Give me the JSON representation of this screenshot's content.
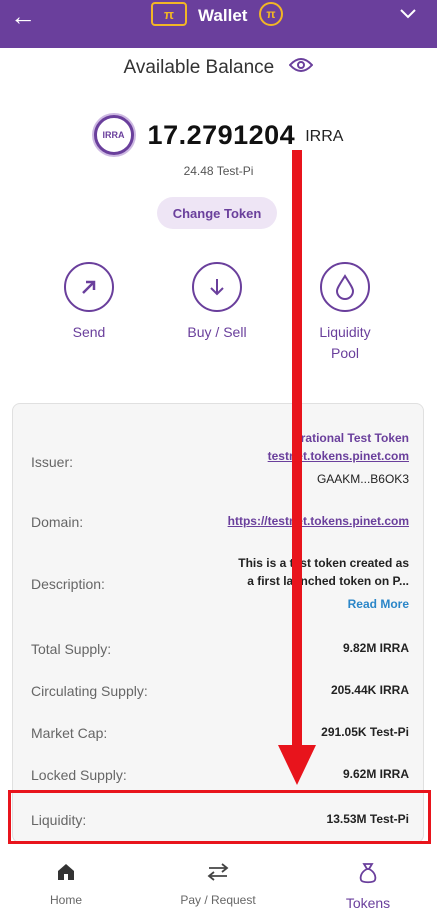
{
  "header": {
    "back_icon": "arrow-left-icon",
    "logo_text": "π",
    "title": "Wallet",
    "pi_coin": "π",
    "chevron_icon": "chevron-down-icon"
  },
  "balance": {
    "available_label": "Available Balance",
    "token_logo_text": "IRRA",
    "amount": "17.2791204",
    "unit": "IRRA",
    "testpi_equiv": "24.48 Test-Pi",
    "change_token_label": "Change Token"
  },
  "actions": [
    {
      "label": "Send",
      "icon": "arrow-up-right-icon"
    },
    {
      "label": "Buy / Sell",
      "icon": "arrow-down-icon"
    },
    {
      "label": "Liquidity\nPool",
      "icon": "droplet-icon"
    }
  ],
  "details": {
    "issuer_label": "Issuer:",
    "issuer_name": "Irrational Test Token",
    "issuer_domain": "testnet.tokens.pinet.com",
    "issuer_key": "GAAKM...B6OK3",
    "domain_label": "Domain:",
    "domain_value": "https://testnet.tokens.pinet.com",
    "description_label": "Description:",
    "description_line1": "This is a test token created as",
    "description_line2": "a first launched token on P...",
    "read_more": "Read More",
    "total_supply_label": "Total Supply:",
    "total_supply_value": "9.82M IRRA",
    "circulating_label": "Circulating Supply:",
    "circulating_value": "205.44K IRRA",
    "market_cap_label": "Market Cap:",
    "market_cap_value": "291.05K Test-Pi",
    "locked_label": "Locked Supply:",
    "locked_value": "9.62M IRRA",
    "liquidity_label": "Liquidity:",
    "liquidity_value": "13.53M Test-Pi"
  },
  "nav": {
    "home": "Home",
    "pay": "Pay / Request",
    "tokens": "Tokens"
  },
  "colors": {
    "brand_purple": "#6a3f9c",
    "accent_gold": "#f2b625",
    "annotation_red": "#e8141c"
  }
}
